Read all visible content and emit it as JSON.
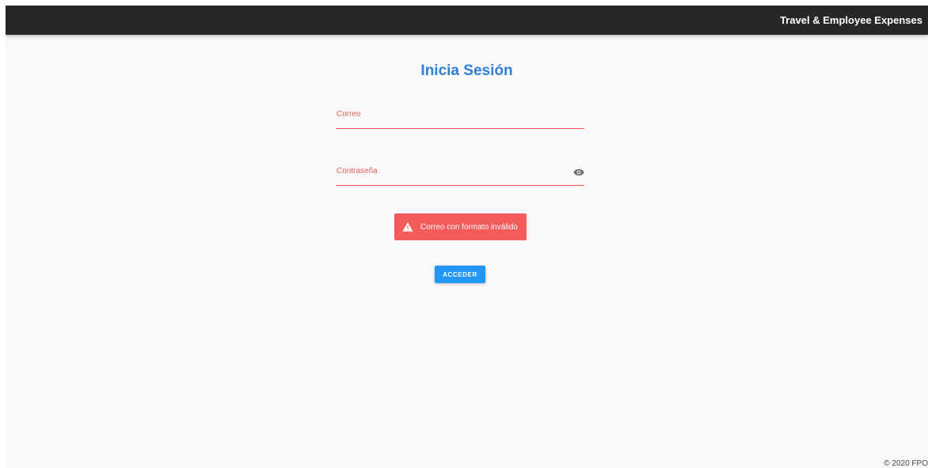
{
  "app": {
    "title": "Travel & Employee Expenses"
  },
  "login": {
    "title": "Inicia Sesión",
    "email_label": "Correo",
    "email_value": "",
    "password_label": "Contraseña",
    "password_value": "",
    "error_message": "Correo con formato inválido",
    "submit_label": "ACCEDER"
  },
  "footer": {
    "text": "© 2020 FPO"
  },
  "colors": {
    "topbar": "#272727",
    "title": "#2f80d6",
    "error": "#f05a5a",
    "alert_bg": "#f45b5b",
    "primary_button": "#2196f3"
  },
  "icons": {
    "password_toggle": "eye-icon",
    "alert": "warning-triangle-icon"
  }
}
